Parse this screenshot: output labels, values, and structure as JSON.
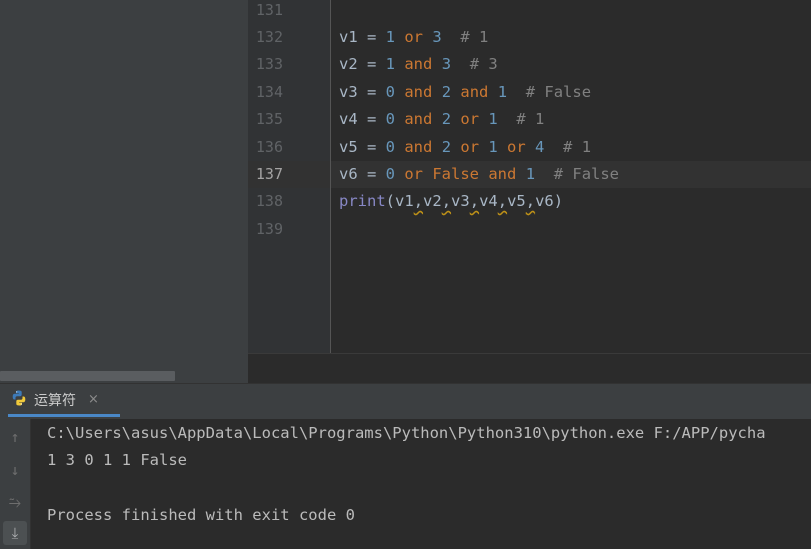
{
  "editor": {
    "lines": [
      {
        "number": "131"
      },
      {
        "number": "132"
      },
      {
        "number": "133"
      },
      {
        "number": "134"
      },
      {
        "number": "135"
      },
      {
        "number": "136"
      },
      {
        "number": "137"
      },
      {
        "number": "138"
      },
      {
        "number": "139"
      }
    ],
    "code": {
      "l132": {
        "var": "v1",
        "eq": " = ",
        "a": "1",
        "op1": " or ",
        "b": "3",
        "comment": "  # 1"
      },
      "l133": {
        "var": "v2",
        "eq": " = ",
        "a": "1",
        "op1": " and ",
        "b": "3",
        "comment": "  # 3"
      },
      "l134": {
        "var": "v3",
        "eq": " = ",
        "a": "0",
        "op1": " and ",
        "b": "2",
        "op2": " and ",
        "c": "1",
        "comment": "  # False"
      },
      "l135": {
        "var": "v4",
        "eq": " = ",
        "a": "0",
        "op1": " and ",
        "b": "2",
        "op2": " or ",
        "c": "1",
        "comment": "  # 1"
      },
      "l136": {
        "var": "v5",
        "eq": " = ",
        "a": "0",
        "op1": " and ",
        "b": "2",
        "op2": " or ",
        "c": "1",
        "op3": " or ",
        "d": "4",
        "comment": "  # 1"
      },
      "l137": {
        "var": "v6",
        "eq": " = ",
        "a": "0",
        "op1": " or ",
        "b": "False",
        "op2": " and ",
        "c": "1",
        "comment": "  # False"
      },
      "l138": {
        "func": "print",
        "open": "(",
        "args": [
          "v1",
          "v2",
          "v3",
          "v4",
          "v5",
          "v6"
        ],
        "comma": ",",
        "close": ")"
      }
    }
  },
  "run_tab": {
    "label": "运算符",
    "close": "×",
    "icon": "python-icon"
  },
  "toolbar": {
    "up": "↑",
    "down": "↓",
    "wrap": "⥲",
    "scroll_end": "⤓"
  },
  "console": {
    "lines": [
      "C:\\Users\\asus\\AppData\\Local\\Programs\\Python\\Python310\\python.exe F:/APP/pycha",
      "1 3 0 1 1 False",
      "",
      "Process finished with exit code 0"
    ]
  },
  "colors": {
    "keyword": "#cc7832",
    "number": "#6897bb",
    "comment": "#808080",
    "builtin": "#8888c6",
    "accent": "#4a88c7"
  }
}
